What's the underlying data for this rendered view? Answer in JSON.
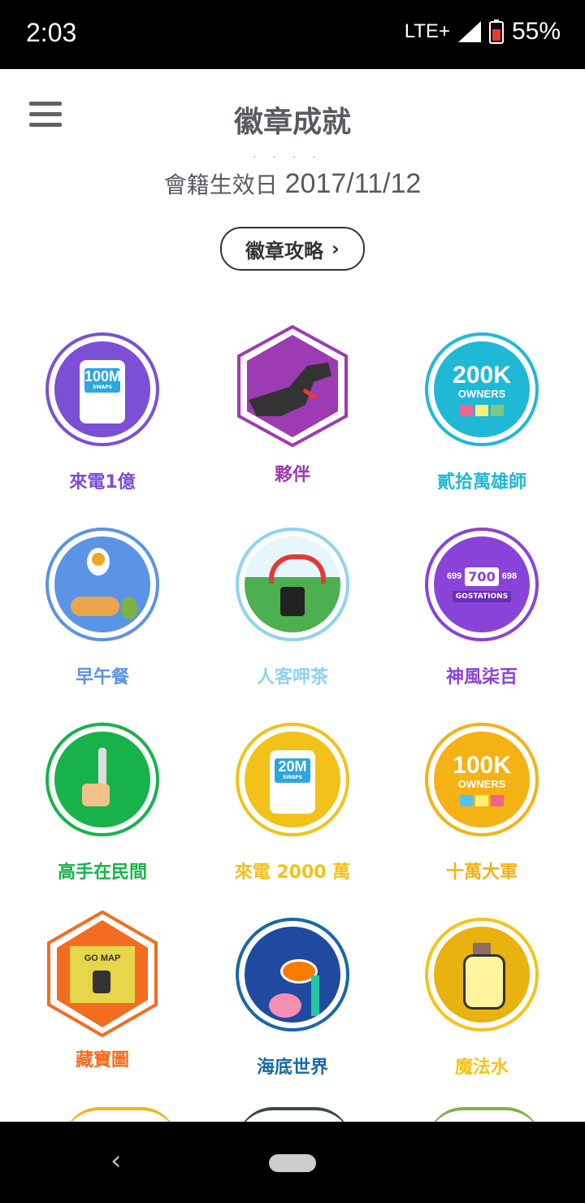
{
  "status": {
    "time": "2:03",
    "network": "LTE+",
    "battery": "55%"
  },
  "header": {
    "title": "徽章成就"
  },
  "profile": {
    "member_since_label": "會籍生效日",
    "member_since_date": "2017/11/12"
  },
  "guide_button": {
    "label": "徽章攻略"
  },
  "badges": [
    {
      "label": "來電1億",
      "text": "100M",
      "sub": "SWAPS",
      "color": "#7b4fd6"
    },
    {
      "label": "夥伴",
      "color": "#9c3bb2"
    },
    {
      "label": "貳拾萬雄師",
      "text": "200K",
      "sub": "OWNERS",
      "color": "#1fb9d6"
    },
    {
      "label": "早午餐",
      "color": "#5b93e6"
    },
    {
      "label": "人客呷茶",
      "color": "#8fd4ef"
    },
    {
      "label": "神風柒百",
      "text": "700",
      "sub": "GOSTATIONS",
      "left_num": "699",
      "right_num": "698",
      "color": "#8a43d8"
    },
    {
      "label": "高手在民間",
      "color": "#17b34a"
    },
    {
      "label": "來電 2000 萬",
      "text": "20M",
      "sub": "SWAPS",
      "color": "#f2c21a"
    },
    {
      "label": "十萬大軍",
      "text": "100K",
      "sub": "OWNERS",
      "color": "#f5b214"
    },
    {
      "label": "藏寶圖",
      "text": "GO MAP",
      "color": "#f36c21"
    },
    {
      "label": "海底世界",
      "color": "#1868a8"
    },
    {
      "label": "魔法水",
      "color": "#f5c417"
    }
  ],
  "icons": {
    "menu": "menu-icon",
    "chevron": "chevron-right-icon",
    "back": "back-icon",
    "home": "home-pill-icon"
  }
}
